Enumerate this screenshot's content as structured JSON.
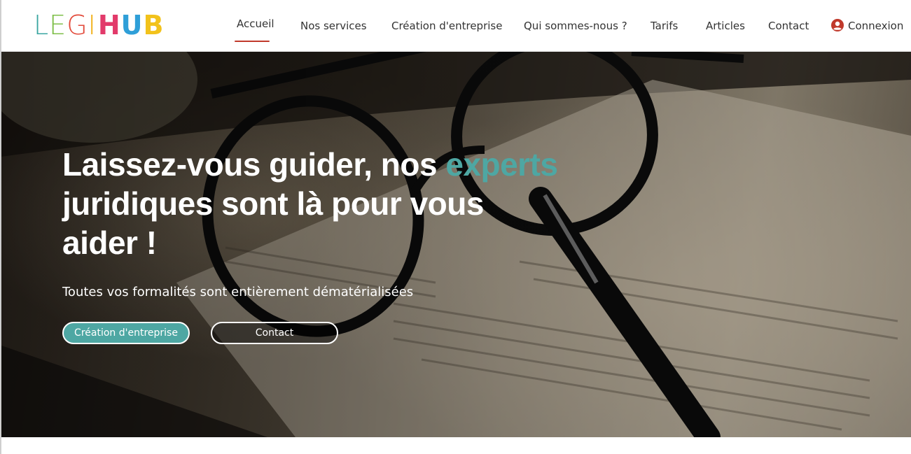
{
  "header": {
    "logo": {
      "part1": "LEGI",
      "part2": "HUB"
    },
    "nav": [
      {
        "label": "Accueil",
        "active": true
      },
      {
        "label": "Nos services"
      },
      {
        "label": "Création d'entreprise"
      },
      {
        "label": "Qui sommes-nous ?"
      },
      {
        "label": "Tarifs"
      },
      {
        "label": "Articles"
      },
      {
        "label": "Contact"
      }
    ],
    "login": {
      "label": "Connexion",
      "icon": "user-circle-icon"
    }
  },
  "hero": {
    "title_before": "Laissez-vous guider, nos ",
    "title_accent": "experts",
    "title_after": " juridiques sont là pour vous aider !",
    "subtitle": "Toutes vos formalités sont entièrement dématérialisées",
    "primary_button": "Création d'entreprise",
    "secondary_button": "Contact"
  },
  "colors": {
    "accent": "#4ea7a3",
    "nav_active_underline": "#c0392b",
    "login_icon": "#c0392b"
  }
}
